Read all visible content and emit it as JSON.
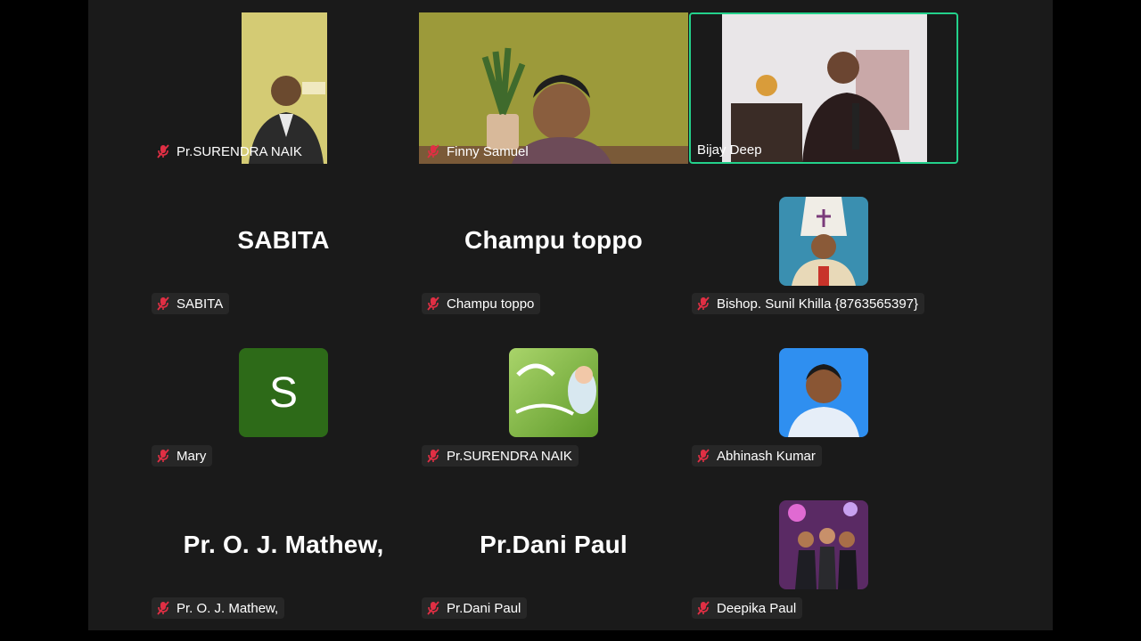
{
  "meeting": {
    "participants": [
      {
        "id": "p1",
        "name": "Pr.SURENDRA NAIK",
        "view": "video",
        "muted": true
      },
      {
        "id": "p2",
        "name": "Finny Samuel",
        "view": "video",
        "muted": true
      },
      {
        "id": "p3",
        "name": "Bijay Deep",
        "view": "video",
        "muted": false,
        "active_speaker": true
      },
      {
        "id": "p4",
        "name": "SABITA",
        "view": "name",
        "display": "SABITA",
        "muted": true
      },
      {
        "id": "p5",
        "name": "Champu toppo",
        "view": "name",
        "display": "Champu toppo",
        "muted": true
      },
      {
        "id": "p6",
        "name": "Bishop. Sunil Khilla {8763565397}",
        "view": "photo",
        "muted": true
      },
      {
        "id": "p7",
        "name": "Mary",
        "view": "initial",
        "initial": "S",
        "muted": true
      },
      {
        "id": "p8",
        "name": "Pr.SURENDRA NAIK",
        "view": "photo",
        "muted": true
      },
      {
        "id": "p9",
        "name": "Abhinash Kumar",
        "view": "photo",
        "muted": true
      },
      {
        "id": "p10",
        "name": "Pr. O. J. Mathew,",
        "view": "name",
        "display": "Pr. O. J. Mathew,",
        "muted": true
      },
      {
        "id": "p11",
        "name": "Pr.Dani Paul",
        "view": "name",
        "display": "Pr.Dani Paul",
        "muted": true
      },
      {
        "id": "p12",
        "name": "Deepika Paul",
        "view": "photo",
        "muted": true
      }
    ]
  },
  "colors": {
    "background": "#1a1a1a",
    "active_border": "#23d18b",
    "muted_icon": "#e02f44",
    "initial_avatar": "#2d6a18"
  },
  "icons": {
    "muted": "mic-off-icon"
  }
}
